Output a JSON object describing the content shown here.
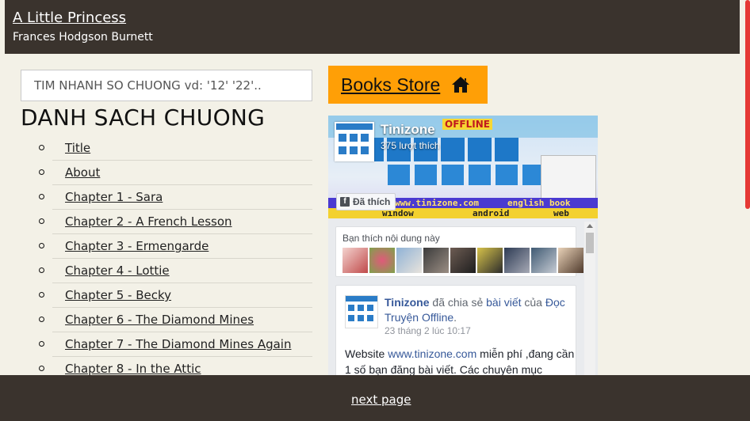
{
  "header": {
    "book_title": "A Little Princess",
    "author": "Frances Hodgson Burnett"
  },
  "search": {
    "placeholder": "TIM NHANH SO CHUONG vd: '12' '22'.."
  },
  "chapters": {
    "heading": "DANH SACH CHUONG",
    "items": [
      "Title",
      "About",
      "Chapter 1 - Sara",
      "Chapter 2 - A French Lesson",
      "Chapter 3 - Ermengarde",
      "Chapter 4 - Lottie",
      "Chapter 5 - Becky",
      "Chapter 6 - The Diamond Mines",
      "Chapter 7 - The Diamond Mines Again",
      "Chapter 8 - In the Attic"
    ]
  },
  "store_button": {
    "label": "Books Store",
    "icon": "home-icon"
  },
  "facebook_widget": {
    "page_name": "Tinizone",
    "likes": "375 lượt thích",
    "liked_button": "Đã thích",
    "cover_text": {
      "offline": "OFFLINE",
      "website": "www.tinizone.com",
      "english": "english book",
      "window": "window",
      "android": "android",
      "web": "web"
    },
    "friends_text": "Bạn thích nội dung này",
    "post": {
      "author": "Tinizone",
      "action": "đã chia sẻ",
      "link1": "bài viết",
      "of": "của",
      "link2": "Đọc Truyện Offline",
      "time": "23 tháng 2 lúc 10:17",
      "body_prefix": "Website",
      "body_url": "www.tinizone.com",
      "body_rest": "miễn phí ,đang cần 1 số bạn đăng bài viết. Các chuyên mục"
    }
  },
  "footer": {
    "next_label": "next page"
  },
  "colors": {
    "header_bg": "#3a332d",
    "page_bg": "#f3f1e7",
    "store_button": "#ff9f06",
    "facebook_link": "#365899",
    "accent_edge": "#e53935"
  }
}
